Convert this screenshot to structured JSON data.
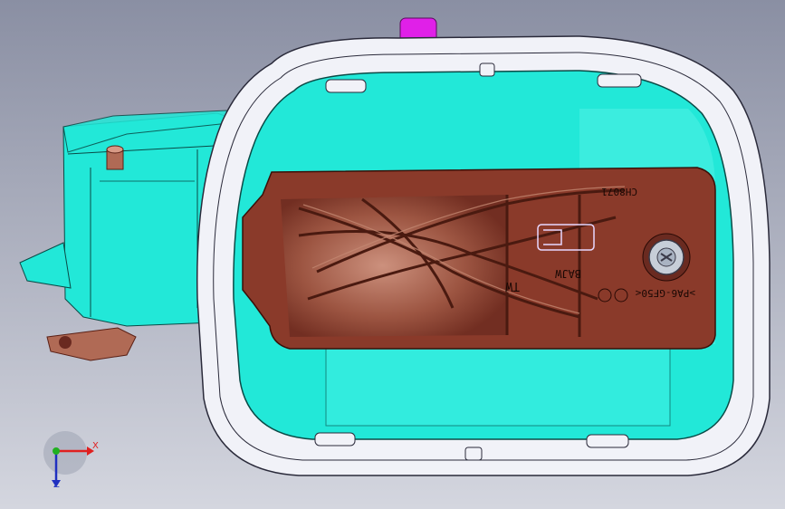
{
  "viewport": {
    "background_top": "#8a8fa3",
    "background_bottom": "#d4d6df"
  },
  "colors": {
    "housing": "#22e8d8",
    "housing_edge": "#0a4a46",
    "bezel": "#f1f2f8",
    "funnel": "#e020e8",
    "rotor": "#8a3a2a",
    "rotor_light": "#b06a55",
    "fastener": "#c7ced8"
  },
  "part_markings": {
    "code": "CH8071",
    "maker": "BAJW",
    "material": ">PA6-GF50<",
    "side": "TW"
  },
  "axis_triad": {
    "x_label": "X",
    "z_label": "Z",
    "x_color": "#e02020",
    "y_color": "#20b020",
    "z_color": "#2030c0"
  }
}
